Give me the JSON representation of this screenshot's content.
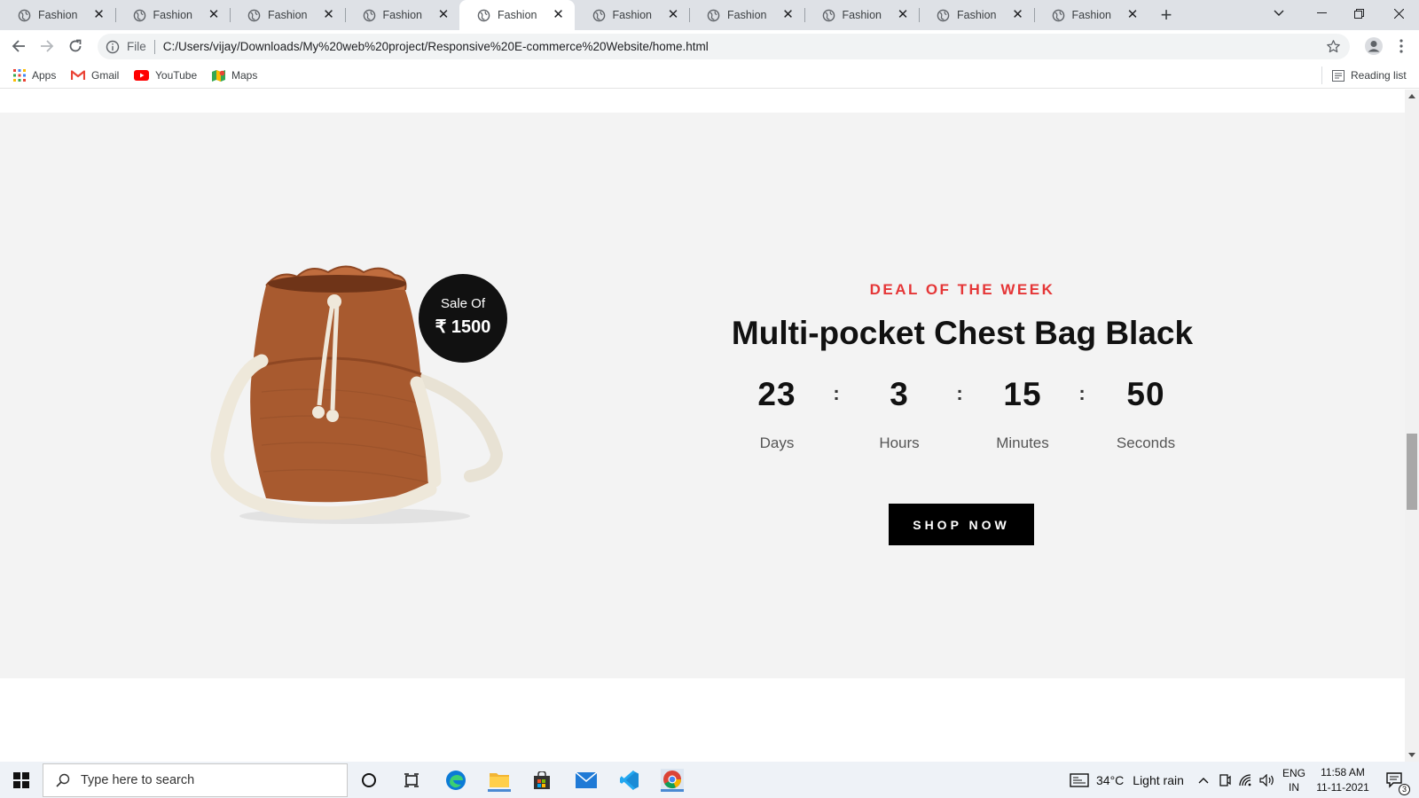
{
  "browser": {
    "tabs": [
      {
        "title": "Fashion",
        "active": false
      },
      {
        "title": "Fashion",
        "active": false
      },
      {
        "title": "Fashion",
        "active": false
      },
      {
        "title": "Fashion",
        "active": false
      },
      {
        "title": "Fashion",
        "active": true
      },
      {
        "title": "Fashion",
        "active": false
      },
      {
        "title": "Fashion",
        "active": false
      },
      {
        "title": "Fashion",
        "active": false
      },
      {
        "title": "Fashion",
        "active": false
      },
      {
        "title": "Fashion",
        "active": false
      }
    ],
    "omnibox": {
      "scheme_label": "File",
      "url": "C:/Users/vijay/Downloads/My%20web%20project/Responsive%20E-commerce%20Website/home.html"
    },
    "bookmarks": [
      {
        "label": "Apps",
        "icon": "apps-grid-icon"
      },
      {
        "label": "Gmail",
        "icon": "gmail-icon"
      },
      {
        "label": "YouTube",
        "icon": "youtube-icon"
      },
      {
        "label": "Maps",
        "icon": "maps-icon"
      }
    ],
    "reading_list": "Reading list"
  },
  "deal": {
    "badge": {
      "line1": "Sale Of",
      "line2": "₹ 1500"
    },
    "kicker": "DEAL OF THE WEEK",
    "title": "Multi-pocket Chest Bag Black",
    "countdown": [
      {
        "value": "23",
        "label": "Days"
      },
      {
        "value": "3",
        "label": "Hours"
      },
      {
        "value": "15",
        "label": "Minutes"
      },
      {
        "value": "50",
        "label": "Seconds"
      }
    ],
    "separator": ":",
    "button": "SHOP NOW",
    "colors": {
      "kicker": "#e53637",
      "section_bg": "#f3f3f3",
      "bag": "#a85a2f",
      "strap": "#e8e2d4"
    }
  },
  "taskbar": {
    "search_placeholder": "Type here to search",
    "weather": {
      "temp": "34°C",
      "desc": "Light rain"
    },
    "language": {
      "line1": "ENG",
      "line2": "IN"
    },
    "clock": {
      "time": "11:58 AM",
      "date": "11-11-2021"
    },
    "notifications": "3"
  }
}
